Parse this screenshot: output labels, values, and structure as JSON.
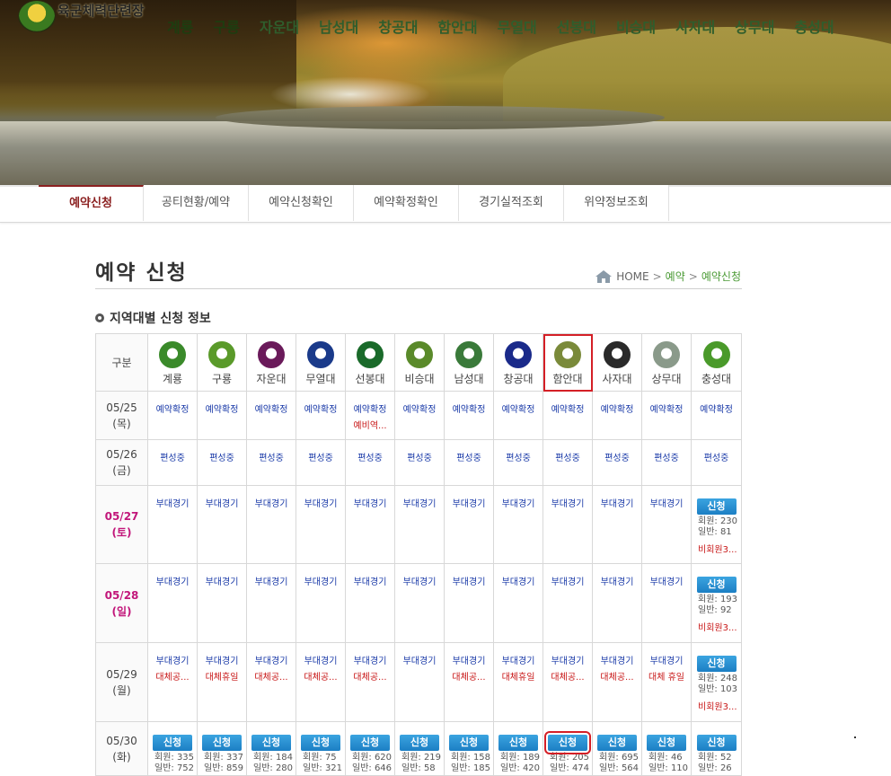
{
  "header": {
    "logo_text": "육군체력단련장",
    "nav": [
      "계룡",
      "구룡",
      "자운대",
      "남성대",
      "창공대",
      "함안대",
      "무열대",
      "선봉대",
      "비승대",
      "사자대",
      "상무대",
      "충성대"
    ]
  },
  "tabs": [
    "예약신청",
    "공티현황/예약",
    "예약신청확인",
    "예약확정확인",
    "경기실적조회",
    "위약정보조회"
  ],
  "active_tab": "예약신청",
  "page": {
    "title": "예약 신청",
    "breadcrumb": [
      "HOME",
      "예약",
      "예약신청"
    ]
  },
  "section": {
    "title": "지역대별 신청 정보"
  },
  "table": {
    "corner": "구분",
    "columns": [
      {
        "name": "계룡",
        "icon": "gyeryong-emblem-icon",
        "color": "#3a8a2a"
      },
      {
        "name": "구룡",
        "icon": "guryong-emblem-icon",
        "color": "#5a9a2a"
      },
      {
        "name": "자운대",
        "icon": "jaundae-emblem-icon",
        "color": "#6a1a5a"
      },
      {
        "name": "무열대",
        "icon": "muyeoldae-emblem-icon",
        "color": "#1a3a8a"
      },
      {
        "name": "선봉대",
        "icon": "seonbongdae-emblem-icon",
        "color": "#1a6a2a"
      },
      {
        "name": "비승대",
        "icon": "biseungdae-emblem-icon",
        "color": "#5a8a2a"
      },
      {
        "name": "남성대",
        "icon": "namseongdae-emblem-icon",
        "color": "#3a7a3a"
      },
      {
        "name": "창공대",
        "icon": "changgongdae-emblem-icon",
        "color": "#1a2a8a"
      },
      {
        "name": "함안대",
        "icon": "hamandae-emblem-icon",
        "color": "#7a8a3a"
      },
      {
        "name": "사자대",
        "icon": "sajadae-emblem-icon",
        "color": "#2a2a2a"
      },
      {
        "name": "상무대",
        "icon": "sangmudae-emblem-icon",
        "color": "#8a9a8a"
      },
      {
        "name": "충성대",
        "icon": "chungseongdae-emblem-icon",
        "color": "#4a9a2a"
      }
    ],
    "rows": [
      {
        "date": "05/25",
        "day": "(목)",
        "weekend": false,
        "cells": [
          {
            "status": "예약확정"
          },
          {
            "status": "예약확정"
          },
          {
            "status": "예약확정"
          },
          {
            "status": "예약확정"
          },
          {
            "status": "예약확정",
            "note": "예비역..."
          },
          {
            "status": "예약확정"
          },
          {
            "status": "예약확정"
          },
          {
            "status": "예약확정"
          },
          {
            "status": "예약확정"
          },
          {
            "status": "예약확정"
          },
          {
            "status": "예약확정"
          },
          {
            "status": "예약확정"
          }
        ]
      },
      {
        "date": "05/26",
        "day": "(금)",
        "weekend": false,
        "cells": [
          {
            "status": "편성중"
          },
          {
            "status": "편성중"
          },
          {
            "status": "편성중"
          },
          {
            "status": "편성중"
          },
          {
            "status": "편성중"
          },
          {
            "status": "편성중"
          },
          {
            "status": "편성중"
          },
          {
            "status": "편성중"
          },
          {
            "status": "편성중"
          },
          {
            "status": "편성중"
          },
          {
            "status": "편성중"
          },
          {
            "status": "편성중"
          }
        ]
      },
      {
        "date": "05/27",
        "day": "(토)",
        "weekend": true,
        "cells": [
          {
            "status": "부대경기"
          },
          {
            "status": "부대경기"
          },
          {
            "status": "부대경기"
          },
          {
            "status": "부대경기"
          },
          {
            "status": "부대경기"
          },
          {
            "status": "부대경기"
          },
          {
            "status": "부대경기"
          },
          {
            "status": "부대경기"
          },
          {
            "status": "부대경기"
          },
          {
            "status": "부대경기"
          },
          {
            "status": "부대경기"
          },
          {
            "apply": "신청",
            "member": "회원: 230",
            "general": "일반: 81",
            "nonmember": "비회원3..."
          }
        ]
      },
      {
        "date": "05/28",
        "day": "(일)",
        "weekend": true,
        "cells": [
          {
            "status": "부대경기"
          },
          {
            "status": "부대경기"
          },
          {
            "status": "부대경기"
          },
          {
            "status": "부대경기"
          },
          {
            "status": "부대경기"
          },
          {
            "status": "부대경기"
          },
          {
            "status": "부대경기"
          },
          {
            "status": "부대경기"
          },
          {
            "status": "부대경기"
          },
          {
            "status": "부대경기"
          },
          {
            "status": "부대경기"
          },
          {
            "apply": "신청",
            "member": "회원: 193",
            "general": "일반: 92",
            "nonmember": "비회원3..."
          }
        ]
      },
      {
        "date": "05/29",
        "day": "(월)",
        "weekend": false,
        "cells": [
          {
            "status": "부대경기",
            "note": "대체공..."
          },
          {
            "status": "부대경기",
            "note": "대체휴일"
          },
          {
            "status": "부대경기",
            "note": "대체공..."
          },
          {
            "status": "부대경기",
            "note": "대체공..."
          },
          {
            "status": "부대경기",
            "note": "대체공..."
          },
          {
            "status": "부대경기"
          },
          {
            "status": "부대경기",
            "note": "대체공..."
          },
          {
            "status": "부대경기",
            "note": "대체휴일"
          },
          {
            "status": "부대경기",
            "note": "대체공..."
          },
          {
            "status": "부대경기",
            "note": "대체공..."
          },
          {
            "status": "부대경기",
            "note": "대체 휴일"
          },
          {
            "apply": "신청",
            "member": "회원: 248",
            "general": "일반: 103",
            "nonmember": "비회원3..."
          }
        ]
      },
      {
        "date": "05/30",
        "day": "(화)",
        "weekend": false,
        "cells": [
          {
            "apply": "신청",
            "member": "회원: 335",
            "general": "일반: 752"
          },
          {
            "apply": "신청",
            "member": "회원: 337",
            "general": "일반: 859"
          },
          {
            "apply": "신청",
            "member": "회원: 184",
            "general": "일반: 280"
          },
          {
            "apply": "신청",
            "member": "회원: 75",
            "general": "일반: 321"
          },
          {
            "apply": "신청",
            "member": "회원: 620",
            "general": "일반: 646"
          },
          {
            "apply": "신청",
            "member": "회원: 219",
            "general": "일반: 58"
          },
          {
            "apply": "신청",
            "member": "회원: 158",
            "general": "일반: 185"
          },
          {
            "apply": "신청",
            "member": "회원: 189",
            "general": "일반: 420"
          },
          {
            "apply": "신청",
            "member": "회원: 205",
            "general": "일반: 474"
          },
          {
            "apply": "신청",
            "member": "회원: 695",
            "general": "일반: 564"
          },
          {
            "apply": "신청",
            "member": "회원: 46",
            "general": "일반: 110"
          },
          {
            "apply": "신청",
            "member": "회원: 52",
            "general": "일반: 26"
          }
        ]
      }
    ]
  },
  "colors": {
    "accent": "#8b2020",
    "breadcrumb_current": "#4a9a34",
    "weekend": "#c2167a",
    "status_blue": "#1a3aa8",
    "note_red": "#c81818",
    "button_blue": "#1c7fc4",
    "highlight": "#d41f26"
  }
}
